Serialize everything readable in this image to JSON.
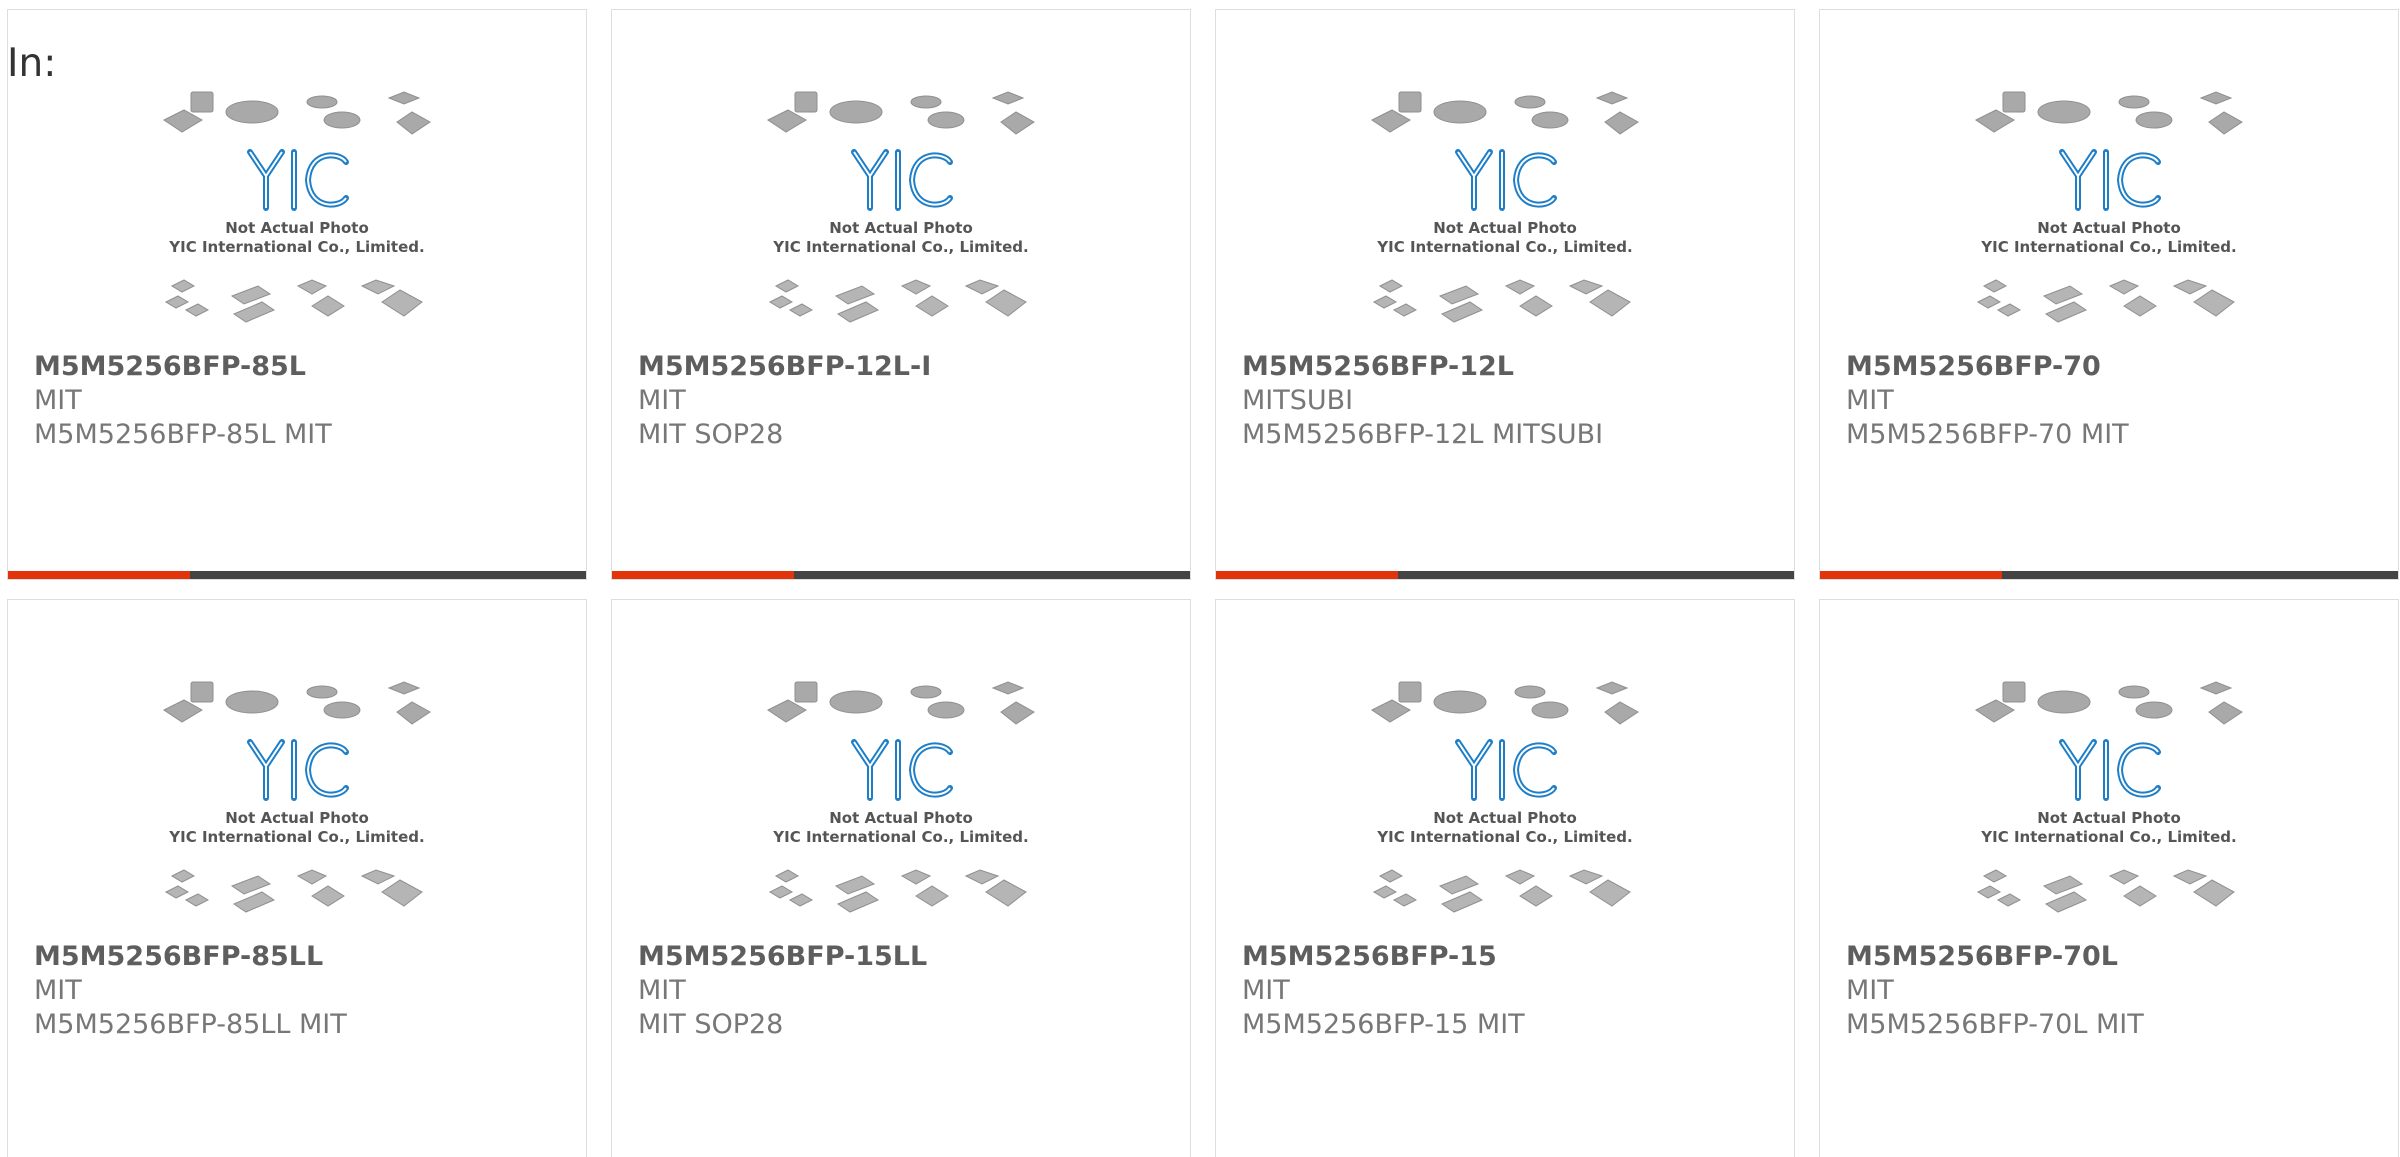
{
  "header": {
    "in_label": "In:"
  },
  "placeholder": {
    "logo_text": "YIC",
    "line1": "Not Actual Photo",
    "line2": "YIC International Co., Limited."
  },
  "colors": {
    "accent_bar": "#e2340b",
    "bar_dark": "#444444",
    "logo_blue": "#1e7fc8",
    "title_text": "#5e5e5e",
    "body_text": "#777777"
  },
  "products": [
    {
      "part": "M5M5256BFP-85L",
      "maker": "MIT",
      "desc": "M5M5256BFP-85L MIT"
    },
    {
      "part": "M5M5256BFP-12L-I",
      "maker": "MIT",
      "desc": "MIT SOP28"
    },
    {
      "part": "M5M5256BFP-12L",
      "maker": "MITSUBI",
      "desc": "M5M5256BFP-12L MITSUBI"
    },
    {
      "part": "M5M5256BFP-70",
      "maker": "MIT",
      "desc": "M5M5256BFP-70 MIT"
    },
    {
      "part": "M5M5256BFP-85LL",
      "maker": "MIT",
      "desc": "M5M5256BFP-85LL MIT"
    },
    {
      "part": "M5M5256BFP-15LL",
      "maker": "MIT",
      "desc": "MIT SOP28"
    },
    {
      "part": "M5M5256BFP-15",
      "maker": "MIT",
      "desc": "M5M5256BFP-15 MIT"
    },
    {
      "part": "M5M5256BFP-70L",
      "maker": "MIT",
      "desc": "M5M5256BFP-70L MIT"
    }
  ]
}
